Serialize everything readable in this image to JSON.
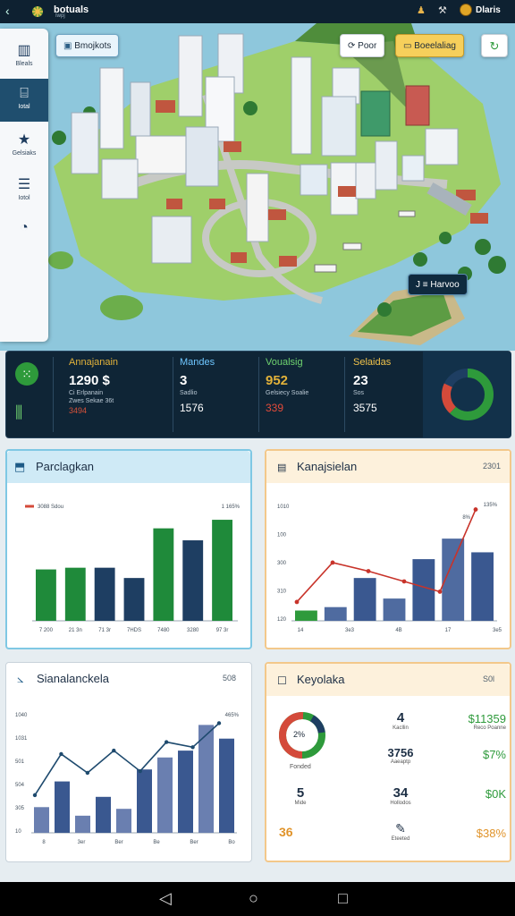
{
  "topbar": {
    "back_icon": "back-arrow-icon",
    "title": "botuals",
    "subtitle": "Iwpj",
    "right_label": "Dlaris"
  },
  "sidebar": {
    "items": [
      {
        "icon": "buildings-icon",
        "label": "Bleals",
        "active": false
      },
      {
        "icon": "building-icon",
        "label": "Iotal",
        "active": true
      },
      {
        "icon": "star-icon",
        "label": "Gelsiaks",
        "active": false
      },
      {
        "icon": "list-icon",
        "label": "Iotol",
        "active": false
      },
      {
        "icon": "gauge-icon",
        "label": "",
        "active": false
      }
    ]
  },
  "map": {
    "tag_label": "Bmojkots",
    "btn_poor": "Poor",
    "btn_boeelaliag": "Boeelaliag",
    "tooltip": "J ≡ Harvoo"
  },
  "stats": {
    "items": [
      {
        "label": "Annajanain",
        "value": "1290 $",
        "sub1": "Ci Erlpanain",
        "sub2": "Zwes Sekae 36t",
        "trend": "3494",
        "color": "#e2b23a",
        "trend_color": "#d8523a"
      },
      {
        "label": "Mandes",
        "value": "3",
        "sub1": "Sadlio",
        "sub2": "",
        "trend": "1576",
        "color": "#6ec6ff",
        "trend_color": "#ffffff"
      },
      {
        "label": "Voualsig",
        "value": "952",
        "sub1": "Gelsiecy Soalie",
        "sub2": "",
        "trend": "339",
        "color": "#6fd36f",
        "trend_color": "#e24b3a"
      },
      {
        "label": "Selaidas",
        "value": "23",
        "sub1": "Sos",
        "sub2": "",
        "trend": "3575",
        "color": "#f0c24a",
        "trend_color": "#ffffff"
      }
    ],
    "donut": {
      "green": 0.62,
      "red": 0.2,
      "dark": 0.18
    }
  },
  "cards": {
    "parclagkan": {
      "title": "Parclagkan",
      "legend": "3088 Sdou",
      "corner": "1 165%",
      "xlabels": [
        "7 200",
        "21 3n",
        "71 3r",
        "7HDS",
        "7480",
        "3280",
        "97 3r"
      ]
    },
    "kanajsielan": {
      "title": "Kanajsielan",
      "right": "2301",
      "corner1": "135%",
      "corner2": "8%",
      "yticks": [
        "1010",
        "100",
        "300",
        "310",
        "120"
      ],
      "xlabels": [
        "14",
        "3e3",
        "4B",
        "17",
        "3e5"
      ]
    },
    "sianalanckela": {
      "title": "Sianalanckela",
      "right": "508",
      "corner": "465%",
      "yticks": [
        "1040",
        "1031",
        "501",
        "504",
        "305",
        "10"
      ],
      "xlabels": [
        "8",
        "3er",
        "Ber",
        "Be",
        "Ber",
        "Bo"
      ]
    },
    "keyolaka": {
      "title": "Keyolaka",
      "right": "S0l",
      "donut_pct": "2%",
      "donut_label": "Fonded",
      "mid_items": [
        {
          "value": "4",
          "sub": "Kacllin"
        },
        {
          "value": "3756",
          "sub": "Aaeaptp"
        },
        {
          "value": "5",
          "sub": "Mide"
        },
        {
          "value": "34",
          "sub": "Hollodos"
        },
        {
          "value": "36",
          "sub": "Eteeted"
        }
      ],
      "right_items": [
        {
          "value": "$11359",
          "sub": "Reco Poanne",
          "color": "#2e9a3b"
        },
        {
          "value": "$7%",
          "sub": "",
          "color": "#2e9a3b"
        },
        {
          "value": "$0K",
          "sub": "",
          "color": "#2e9a3b"
        },
        {
          "value": "$38%",
          "sub": "",
          "color": "#e0932a"
        }
      ],
      "bottom_left": "36"
    }
  },
  "chart_data": [
    {
      "type": "bar",
      "title": "Parclagkan",
      "categories": [
        "7 200",
        "21 3n",
        "71 3r",
        "7HDS",
        "7480",
        "3280",
        "97 3r"
      ],
      "values": [
        60,
        62,
        62,
        50,
        108,
        94,
        118
      ],
      "colors": [
        "#1f8a3a",
        "#1f8a3a",
        "#1e3e62",
        "#1e3e62",
        "#1f8a3a",
        "#1e3e62",
        "#1f8a3a"
      ],
      "ylim": [
        0,
        140
      ]
    },
    {
      "type": "bar+line",
      "title": "Kanajsielan",
      "categories": [
        "14",
        "3e3",
        "4B",
        "17",
        "3e5"
      ],
      "bars": [
        12,
        16,
        50,
        26,
        72,
        96,
        80
      ],
      "line": [
        22,
        68,
        58,
        46,
        34,
        130
      ],
      "ylim": [
        0,
        140
      ]
    },
    {
      "type": "bar+line",
      "title": "Sianalanckela",
      "categories": [
        "8",
        "3er",
        "Ber",
        "Be",
        "Ber",
        "Bo"
      ],
      "bars": [
        30,
        60,
        20,
        42,
        28,
        74,
        88,
        96,
        126,
        110
      ],
      "line": [
        44,
        92,
        70,
        96,
        72,
        106,
        100,
        128
      ],
      "ylim": [
        0,
        140
      ]
    }
  ]
}
